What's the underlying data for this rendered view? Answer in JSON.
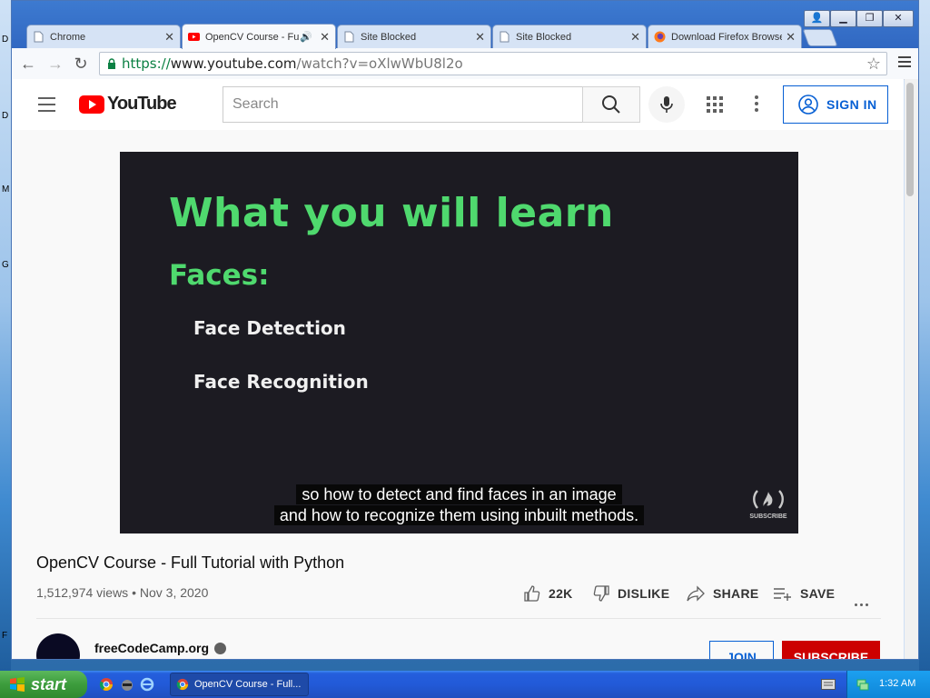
{
  "desktop": {
    "edge_letters": [
      "D",
      "M",
      "G",
      "F"
    ]
  },
  "browser": {
    "tabs": [
      {
        "title": "Chrome",
        "active": false
      },
      {
        "title": "OpenCV Course - Full",
        "active": true,
        "audio": true
      },
      {
        "title": "Site Blocked",
        "active": false
      },
      {
        "title": "Site Blocked",
        "active": false
      },
      {
        "title": "Download Firefox Browse",
        "active": false
      }
    ],
    "url": {
      "scheme": "https://",
      "host": "www.youtube.com",
      "path": "/watch?v=oXlwWbU8l2o"
    }
  },
  "youtube": {
    "logo_text": "YouTube",
    "search_placeholder": "Search",
    "sign_in_label": "SIGN IN",
    "slide": {
      "heading": "What you will learn",
      "subheading": "Faces:",
      "items": [
        "Face Detection",
        "Face Recognition"
      ]
    },
    "captions": [
      "so how to detect and find faces in an image",
      "and how to recognize them using inbuilt methods."
    ],
    "watermark": "SUBSCRIBE",
    "video_title": "OpenCV Course - Full Tutorial with Python",
    "views": "1,512,974 views",
    "date": "Nov 3, 2020",
    "actions": {
      "likes": "22K",
      "dislike": "DISLIKE",
      "share": "SHARE",
      "save": "SAVE"
    },
    "channel": {
      "name": "freeCodeCamp.org",
      "join": "JOIN",
      "subscribe": "SUBSCRIBE"
    }
  },
  "taskbar": {
    "start_label": "start",
    "task_label": "OpenCV Course - Full...",
    "clock": "1:32 AM"
  }
}
